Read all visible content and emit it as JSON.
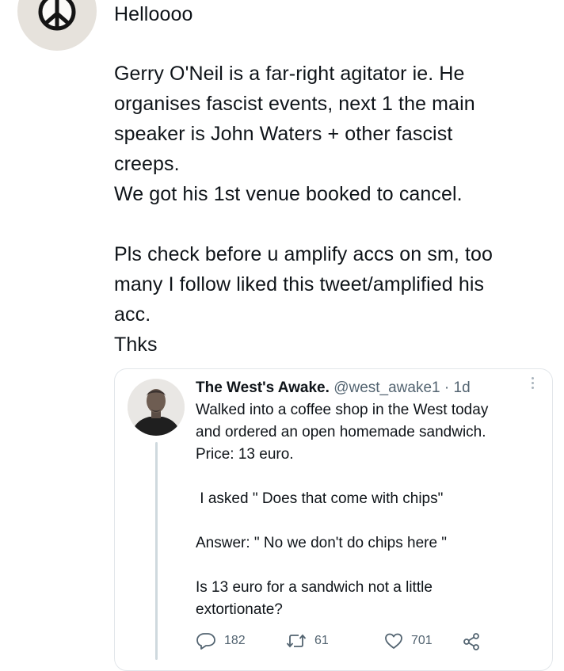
{
  "tweet": {
    "greeting": "Helloooo",
    "paragraph1": [
      "Gerry O'Neil is a far-right agitator ie. He",
      "organises fascist events, next 1 the main",
      "speaker is John Waters + other fascist",
      "creeps.",
      "We got his 1st venue booked to cancel."
    ],
    "paragraph2": [
      "Pls check before u amplify accs on sm, too",
      "many I follow liked this tweet/amplified his",
      "acc.",
      "Thks"
    ]
  },
  "quoted_tweet": {
    "display_name": "The West's Awake.",
    "handle": "@west_awake1",
    "separator": "·",
    "time": "1d",
    "body": {
      "line1": "Walked into a coffee shop in the West today",
      "line2": "and ordered an open homemade sandwich.",
      "line3": "Price: 13 euro.",
      "line4": " I asked \" Does that come with chips\"",
      "line5": "Answer: \" No we don't do chips here \"",
      "line6": "Is 13 euro for a sandwich not a little",
      "line7": "extortionate?"
    },
    "actions": {
      "replies": "182",
      "retweets": "61",
      "likes": "701"
    }
  },
  "icons": {
    "avatar": "peace-sign-icon",
    "reply": "reply-icon",
    "retweet": "retweet-icon",
    "like": "heart-icon",
    "share": "share-icon",
    "more": "more-options-icon"
  },
  "colors": {
    "text": "#0f1419",
    "muted": "#536471",
    "border": "#e2e6ea",
    "thread": "#cfd9de"
  }
}
